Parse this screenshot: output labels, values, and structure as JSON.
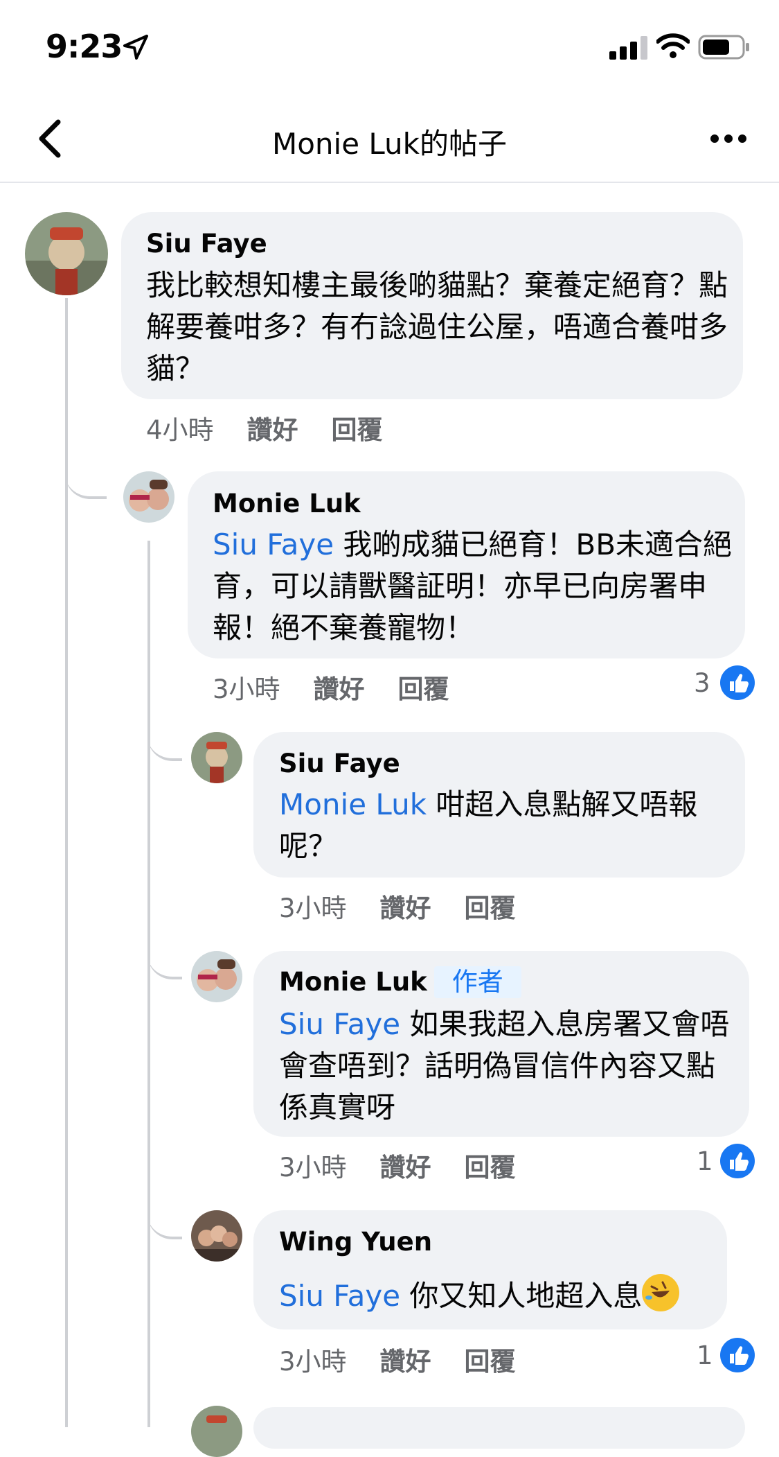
{
  "status": {
    "time": "9:23"
  },
  "nav": {
    "title": "Monie Luk的帖子"
  },
  "comments": [
    {
      "name": "Siu Faye",
      "text": "我比較想知樓主最後啲貓點？棄養定絕育？點解要養咁多？有冇諗過住公屋，唔適合養咁多貓？",
      "time": "4小時",
      "like": "讚好",
      "reply": "回覆"
    },
    {
      "name": "Monie Luk",
      "mention": "Siu Faye",
      "text": "我啲成貓已絕育！BB未適合絕育，可以請獸醫証明！亦早已向房署申報！絕不棄養寵物！",
      "time": "3小時",
      "like": "讚好",
      "reply": "回覆",
      "likes": "3"
    },
    {
      "name": "Siu Faye",
      "mention": "Monie Luk",
      "text": "咁超入息點解又唔報呢？",
      "time": "3小時",
      "like": "讚好",
      "reply": "回覆"
    },
    {
      "name": "Monie Luk",
      "badge": "作者",
      "mention": "Siu Faye",
      "text": "如果我超入息房署又會唔會查唔到？話明偽冒信件內容又點係真實呀",
      "time": "3小時",
      "like": "讚好",
      "reply": "回覆",
      "likes": "1"
    },
    {
      "name": "Wing Yuen",
      "mention": "Siu Faye",
      "text": "你又知人地超入息",
      "emoji": "rolling-on-floor-laughing-emoji",
      "time": "3小時",
      "like": "讚好",
      "reply": "回覆",
      "likes": "1"
    }
  ],
  "colors": {
    "mention": "#216fdb",
    "like_blue": "#1877f2",
    "bubble": "#f0f2f5"
  }
}
